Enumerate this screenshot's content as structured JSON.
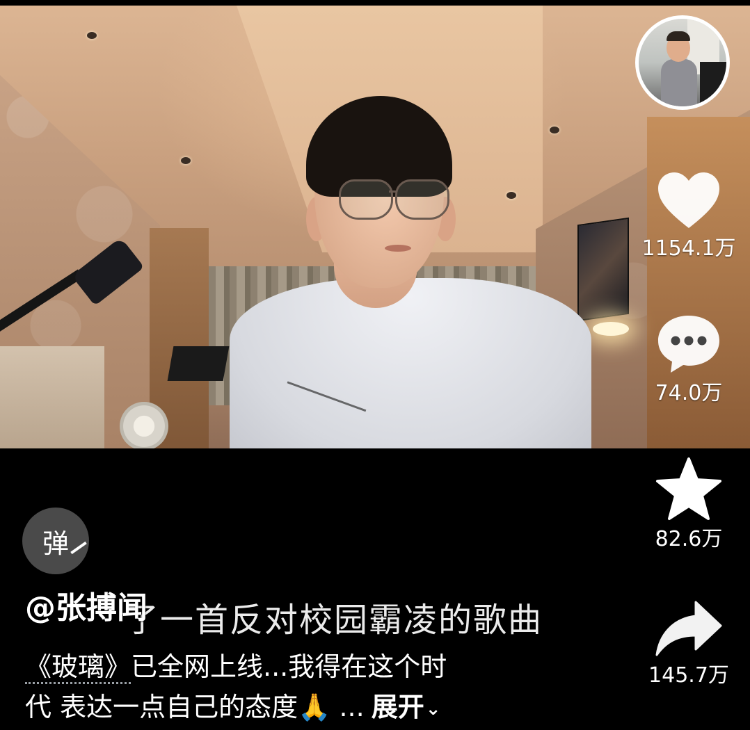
{
  "avatar": {
    "icon": "avatar-icon"
  },
  "actions": {
    "like": {
      "icon": "heart-icon",
      "count": "1154.1万"
    },
    "comment": {
      "icon": "comment-icon",
      "count": "74.0万"
    },
    "favorite": {
      "icon": "star-icon",
      "count": "82.6万"
    },
    "share": {
      "icon": "share-icon",
      "count": "145.7万"
    }
  },
  "danmaku": {
    "label": "弹"
  },
  "video": {
    "overlay_text": "了一首反对校园霸凌的歌曲"
  },
  "post": {
    "author": "@张搏闻",
    "desc_book": "《玻璃》",
    "desc_line1": "已全网上线...我得在这个时",
    "desc_line2": "代 表达一点自己的态度🙏 ...",
    "expand_label": "展开",
    "expand_chevron": "⌄"
  },
  "colors": {
    "background": "#000000",
    "text": "#ffffff",
    "icon": "#ffffff",
    "danmaku_bg": "#4a4a4a"
  }
}
